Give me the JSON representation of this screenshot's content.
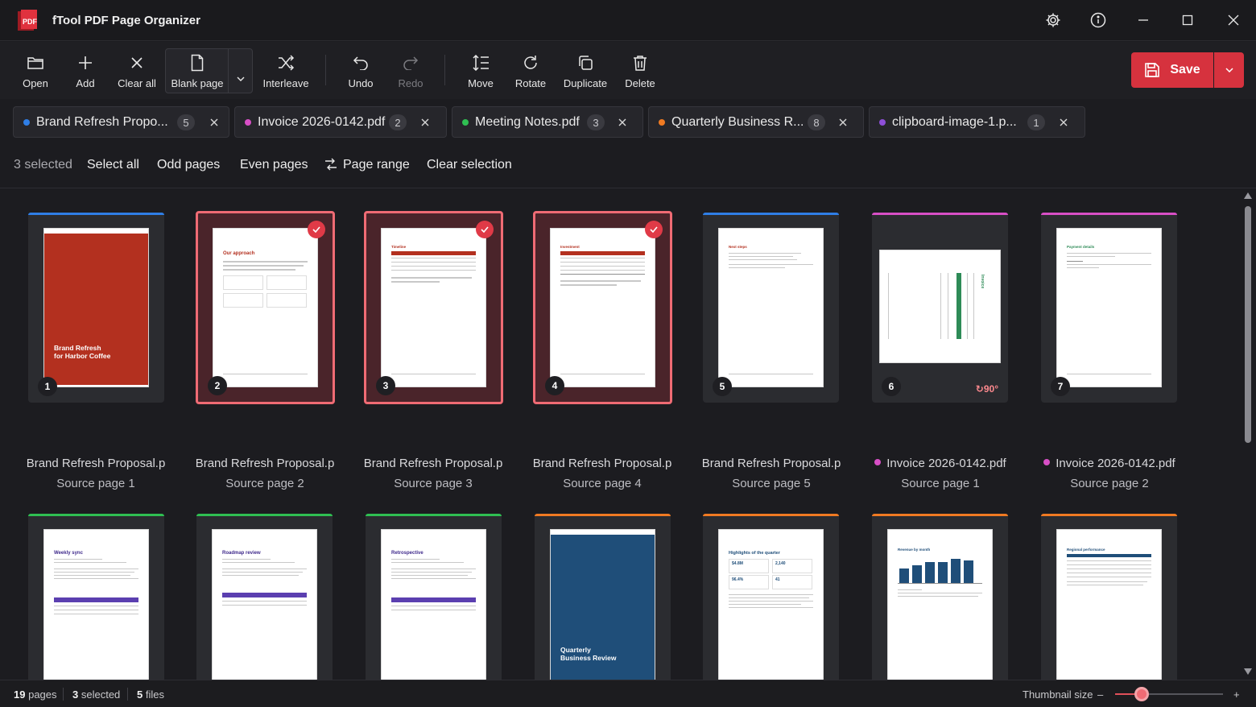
{
  "app": {
    "title": "fTool PDF Page Organizer",
    "logo_text": "PDF"
  },
  "window_controls": [
    "settings-icon",
    "info-icon",
    "minimize-icon",
    "maximize-icon",
    "close-icon"
  ],
  "toolbar": {
    "open": "Open",
    "add": "Add",
    "clear_all": "Clear all",
    "blank_page": "Blank page",
    "interleave": "Interleave",
    "undo": "Undo",
    "redo": "Redo",
    "move": "Move",
    "rotate": "Rotate",
    "duplicate": "Duplicate",
    "delete": "Delete",
    "save": "Save"
  },
  "files": [
    {
      "name": "Brand Refresh Propo...",
      "count": "5",
      "color": "#2f7ee6"
    },
    {
      "name": "Invoice 2026-0142.pdf",
      "count": "2",
      "color": "#d84fc6"
    },
    {
      "name": "Meeting Notes.pdf",
      "count": "3",
      "color": "#2fbf52"
    },
    {
      "name": "Quarterly Business R...",
      "count": "8",
      "color": "#f07a22"
    },
    {
      "name": "clipboard-image-1.p...",
      "count": "1",
      "color": "#8e4fd8"
    }
  ],
  "selection": {
    "count": "3 selected",
    "select_all": "Select all",
    "odd_pages": "Odd pages",
    "even_pages": "Even pages",
    "page_range": "Page range",
    "clear_selection": "Clear selection"
  },
  "pages": [
    {
      "num": "1",
      "file": "Brand Refresh Proposal.p",
      "source": "Source page 1",
      "selected": false,
      "cover_line1": "Brand Refresh",
      "cover_line2": "for Harbor Coffee"
    },
    {
      "num": "2",
      "file": "Brand Refresh Proposal.p",
      "source": "Source page 2",
      "selected": true,
      "heading": "Our approach"
    },
    {
      "num": "3",
      "file": "Brand Refresh Proposal.p",
      "source": "Source page 3",
      "selected": true,
      "heading": "Timeline"
    },
    {
      "num": "4",
      "file": "Brand Refresh Proposal.p",
      "source": "Source page 4",
      "selected": true,
      "heading": "Investment"
    },
    {
      "num": "5",
      "file": "Brand Refresh Proposal.p",
      "source": "Source page 5",
      "selected": false,
      "heading": "Next steps"
    },
    {
      "num": "6",
      "file": "Invoice 2026-0142.pdf",
      "source": "Source page 1",
      "selected": false,
      "rotation": "↻90°",
      "heading": "Invoice"
    },
    {
      "num": "7",
      "file": "Invoice 2026-0142.pdf",
      "source": "Source page 2",
      "selected": false,
      "heading": "Payment details"
    }
  ],
  "row2_pages": [
    {
      "heading": "Weekly sync"
    },
    {
      "heading": "Roadmap review"
    },
    {
      "heading": "Retrospective"
    },
    {
      "cover_line1": "Quarterly",
      "cover_line2": "Business Review"
    },
    {
      "heading": "Highlights of the quarter",
      "kpi1": "$4.8M",
      "kpi2": "2,140",
      "kpi3": "96.4%",
      "kpi4": "41"
    },
    {
      "heading": "Revenue by month"
    },
    {
      "heading": "Regional performance"
    }
  ],
  "status": {
    "pages_num": "19",
    "pages_label": "pages",
    "selected_num": "3",
    "selected_label": "selected",
    "files_num": "5",
    "files_label": "files",
    "thumb_label": "Thumbnail size",
    "thumb_minus": "–",
    "thumb_plus": "+",
    "thumbnail_size_fraction": 0.24
  }
}
